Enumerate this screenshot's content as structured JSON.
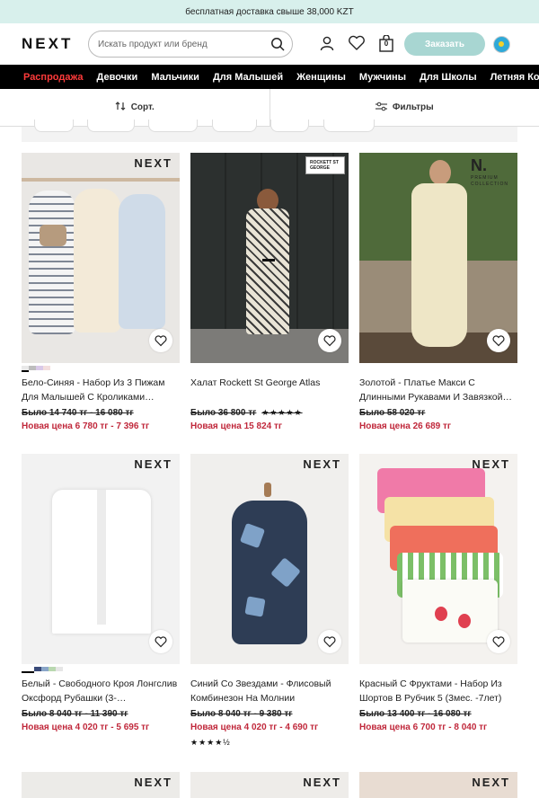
{
  "promo": {
    "text": "бесплатная доставка свыше 38,000 KZT"
  },
  "header": {
    "logo": "NEXT",
    "search_placeholder": "Искать продукт или бренд",
    "order_label": "Заказать",
    "bag_count": "0"
  },
  "nav": {
    "items": [
      "Распродажа",
      "Девочки",
      "Мальчики",
      "Для Малышей",
      "Женщины",
      "Мужчины",
      "Для Школы",
      "Летняя Ко"
    ]
  },
  "sortbar": {
    "sort_label": "Сорт.",
    "filter_label": "Фильтры"
  },
  "products": [
    {
      "brand": "NEXT",
      "title": "Бело-Синяя - Набор Из 3 Пижам Для Малышей С Кроликами…",
      "old_price": "Было 14 740 тг - 16 080 тг",
      "new_price": "Новая цена 6 780 тг - 7 396 тг",
      "rating": ""
    },
    {
      "brand": "ROCKETT ST GEORGE",
      "title": "Халат Rockett St George Atlas",
      "old_price": "Было 36 800 тг",
      "new_price": "Новая цена 15 824 тг",
      "rating": "★★★★★"
    },
    {
      "brand": "N.",
      "brand_sub": "PREMIUM COLLECTION",
      "title": "Золотой - Платье Макси С Длинными Рукавами И Завязкой…",
      "old_price": "Было 58 020 тг",
      "new_price": "Новая цена 26 689 тг",
      "rating": ""
    },
    {
      "brand": "NEXT",
      "title": "Белый - Свободного Кроя Лонгслив Оксфорд Рубашки (3-…",
      "old_price": "Было 8 040 тг - 11 390 тг",
      "new_price": "Новая цена 4 020 тг - 5 695 тг",
      "rating": ""
    },
    {
      "brand": "NEXT",
      "title": "Синий Со Звездами - Флисовый Комбинезон На Молнии",
      "old_price": "Было 8 040 тг - 9 380 тг",
      "new_price": "Новая цена 4 020 тг - 4 690 тг",
      "rating": "★★★★½"
    },
    {
      "brand": "NEXT",
      "title": "Красный С Фруктами - Набор Из Шортов В Рубчик 5 (3мес. -7лет)",
      "old_price": "Было 13 400 тг - 16 080 тг",
      "new_price": "Новая цена 6 700 тг - 8 040 тг",
      "rating": ""
    },
    {
      "brand": "NEXT"
    },
    {
      "brand": "NEXT"
    },
    {
      "brand": "NEXT"
    }
  ],
  "colors": {
    "promo_bg": "#d8f0ec",
    "nav_bg": "#000000",
    "sale": "#ff3b3b",
    "price_red": "#c0283b",
    "order_btn": "#a8d6d2"
  }
}
